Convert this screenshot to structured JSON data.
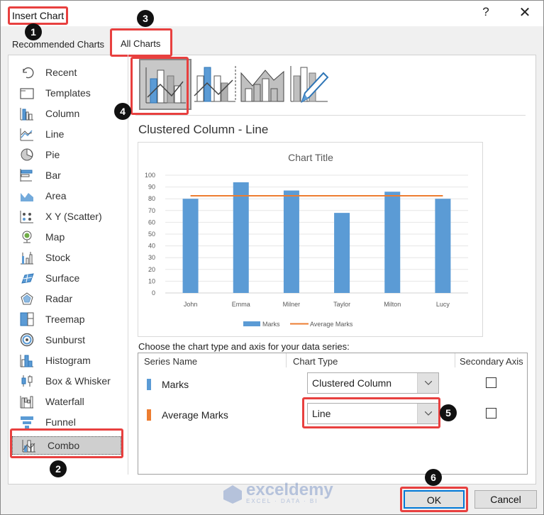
{
  "dialog": {
    "title": "Insert Chart",
    "help_label": "?",
    "close_label": "✕"
  },
  "tabs": [
    {
      "label": "Recommended Charts",
      "selected": false
    },
    {
      "label": "All Charts",
      "selected": true
    }
  ],
  "sidebar": {
    "items": [
      {
        "label": "Recent",
        "icon": "recent-icon"
      },
      {
        "label": "Templates",
        "icon": "templates-icon"
      },
      {
        "label": "Column",
        "icon": "column-chart-icon"
      },
      {
        "label": "Line",
        "icon": "line-chart-icon"
      },
      {
        "label": "Pie",
        "icon": "pie-chart-icon"
      },
      {
        "label": "Bar",
        "icon": "bar-chart-icon"
      },
      {
        "label": "Area",
        "icon": "area-chart-icon"
      },
      {
        "label": "X Y (Scatter)",
        "icon": "scatter-chart-icon"
      },
      {
        "label": "Map",
        "icon": "map-chart-icon"
      },
      {
        "label": "Stock",
        "icon": "stock-chart-icon"
      },
      {
        "label": "Surface",
        "icon": "surface-chart-icon"
      },
      {
        "label": "Radar",
        "icon": "radar-chart-icon"
      },
      {
        "label": "Treemap",
        "icon": "treemap-chart-icon"
      },
      {
        "label": "Sunburst",
        "icon": "sunburst-chart-icon"
      },
      {
        "label": "Histogram",
        "icon": "histogram-chart-icon"
      },
      {
        "label": "Box & Whisker",
        "icon": "box-whisker-chart-icon"
      },
      {
        "label": "Waterfall",
        "icon": "waterfall-chart-icon"
      },
      {
        "label": "Funnel",
        "icon": "funnel-chart-icon"
      },
      {
        "label": "Combo",
        "icon": "combo-chart-icon",
        "selected": true
      }
    ]
  },
  "subtypes": [
    {
      "name": "Clustered Column - Line",
      "selected": true
    },
    {
      "name": "Clustered Column - Line on Secondary Axis",
      "selected": false
    },
    {
      "name": "Stacked Area - Clustered Column",
      "selected": false
    },
    {
      "name": "Custom Combination",
      "selected": false
    }
  ],
  "selected_subtype_label": "Clustered Column - Line",
  "chart_data": {
    "type": "bar",
    "title": "Chart Title",
    "categories": [
      "John",
      "Emma",
      "Milner",
      "Taylor",
      "Milton",
      "Lucy"
    ],
    "series": [
      {
        "name": "Marks",
        "kind": "column",
        "color": "#5b9bd5",
        "values": [
          80,
          94,
          87,
          68,
          86,
          80
        ]
      },
      {
        "name": "Average Marks",
        "kind": "line",
        "color": "#ed7d31",
        "values": [
          82.5,
          82.5,
          82.5,
          82.5,
          82.5,
          82.5
        ]
      }
    ],
    "yticks": [
      "0",
      "10",
      "20",
      "30",
      "40",
      "50",
      "60",
      "70",
      "80",
      "90",
      "100"
    ],
    "ylim": [
      0,
      100
    ],
    "xlabel": "",
    "ylabel": "",
    "grid": true,
    "legend": "bottom"
  },
  "series_table": {
    "caption": "Choose the chart type and axis for your data series:",
    "headers": [
      "Series Name",
      "Chart Type",
      "Secondary Axis"
    ],
    "rows": [
      {
        "name": "Marks",
        "color": "#5b9bd5",
        "chart_type": "Clustered Column",
        "secondary_axis": false
      },
      {
        "name": "Average Marks",
        "color": "#ed7d31",
        "chart_type": "Line",
        "secondary_axis": false
      }
    ]
  },
  "buttons": {
    "ok": "OK",
    "cancel": "Cancel"
  },
  "annotations": [
    "1",
    "2",
    "3",
    "4",
    "5",
    "6"
  ],
  "watermark": {
    "name": "exceldemy",
    "tagline": "EXCEL · DATA · BI"
  }
}
